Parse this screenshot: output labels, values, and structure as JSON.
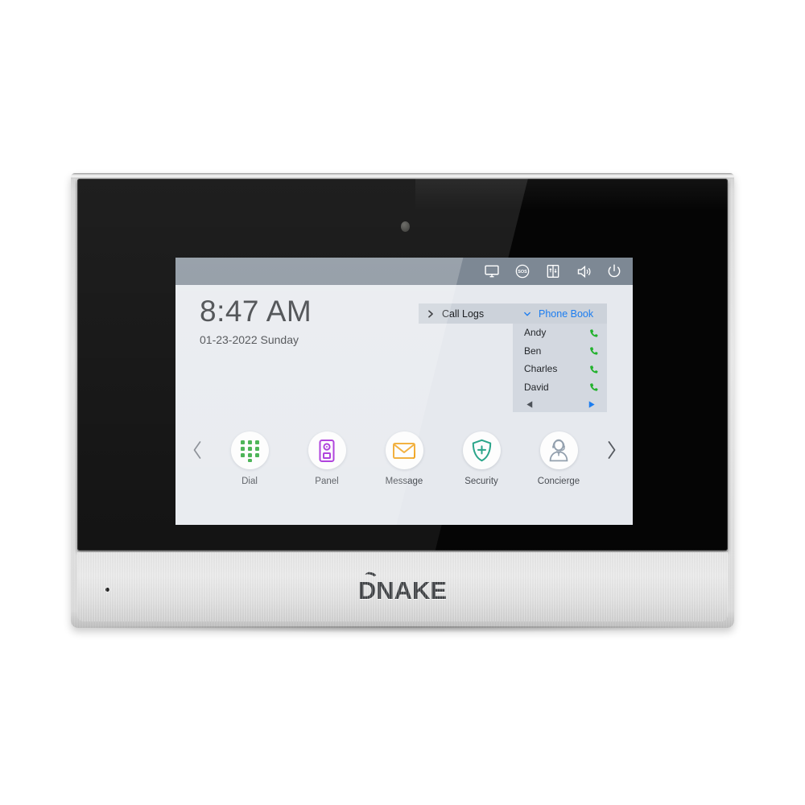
{
  "device": {
    "brand": "DNAKE",
    "camera_icon": "camera-sensor-icon",
    "mic_icon": "microphone-hole-icon"
  },
  "statusbar": {
    "icons": [
      {
        "name": "monitor-icon",
        "label": "Monitor"
      },
      {
        "name": "sos-icon",
        "label": "SOS"
      },
      {
        "name": "elevator-icon",
        "label": "Elevator"
      },
      {
        "name": "volume-icon",
        "label": "Volume"
      },
      {
        "name": "power-icon",
        "label": "Power"
      }
    ]
  },
  "clock": {
    "time": "8:47 AM",
    "date": "01-23-2022 Sunday"
  },
  "call_panel": {
    "left_tab": {
      "label": "Call Logs",
      "chevron": "chevron-right-icon",
      "expanded": "false"
    },
    "right_tab": {
      "label": "Phone Book",
      "chevron": "chevron-down-icon",
      "expanded": "true"
    },
    "contacts": [
      {
        "name": "Andy",
        "action_icon": "phone-call-icon"
      },
      {
        "name": "Ben",
        "action_icon": "phone-call-icon"
      },
      {
        "name": "Charles",
        "action_icon": "phone-call-icon"
      },
      {
        "name": "David",
        "action_icon": "phone-call-icon"
      }
    ],
    "pager": {
      "prev_icon": "triangle-left-icon",
      "next_icon": "triangle-right-icon"
    }
  },
  "dock": {
    "prev_arrow": "chevron-left-icon",
    "next_arrow": "chevron-right-icon",
    "apps": [
      {
        "label": "Dial",
        "icon": "dialpad-icon",
        "color": "#2fa83c"
      },
      {
        "label": "Panel",
        "icon": "door-station-icon",
        "color": "#a324d7"
      },
      {
        "label": "Message",
        "icon": "envelope-icon",
        "color": "#f0a420"
      },
      {
        "label": "Security",
        "icon": "shield-plus-icon",
        "color": "#2aa58a"
      },
      {
        "label": "Concierge",
        "icon": "operator-headset-icon",
        "color": "#93a0ae"
      }
    ]
  },
  "colors": {
    "statusbar_bg": "#7d8894",
    "screen_bg": "#e6e9ee",
    "tab_header_bg": "#ccd2da",
    "tab_body_bg": "#d3d8e0",
    "accent_blue": "#1c7df0",
    "phone_green": "#22b22d"
  }
}
